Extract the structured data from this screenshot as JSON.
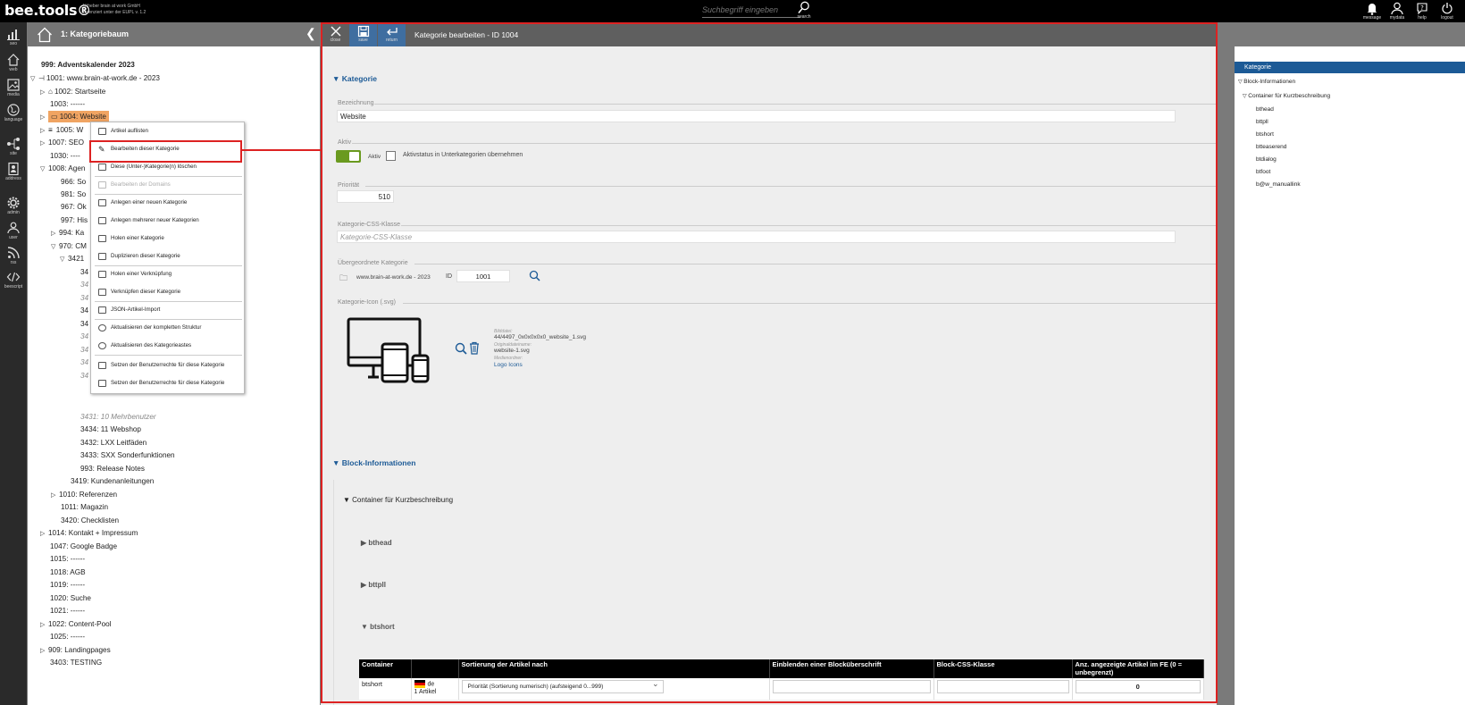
{
  "app": {
    "logo": "bee.tools®",
    "copyright_line1": "Urheber brain at work GmbH",
    "copyright_line2": "Lizenziert unter der EUPL v. 1.2",
    "search_placeholder": "Suchbegriff eingeben",
    "search_label": "search",
    "top_actions": [
      {
        "label": "message",
        "icon": "bell-icon"
      },
      {
        "label": "mydata",
        "icon": "user-icon"
      },
      {
        "label": "help",
        "icon": "help-icon"
      },
      {
        "label": "logout",
        "icon": "logout-icon"
      }
    ]
  },
  "leftnav": [
    {
      "label": "seo",
      "icon": "chart-icon"
    },
    {
      "label": "web",
      "icon": "home-icon"
    },
    {
      "label": "media",
      "icon": "image-icon"
    },
    {
      "label": "language",
      "icon": "globe-icon"
    },
    {
      "label": "site",
      "icon": "sitemap-icon"
    },
    {
      "label": "address",
      "icon": "address-icon"
    },
    {
      "label": "admin",
      "icon": "gear-icon"
    },
    {
      "label": "user",
      "icon": "users-icon"
    },
    {
      "label": "rss",
      "icon": "rss-icon"
    },
    {
      "label": "beescript",
      "icon": "code-icon"
    }
  ],
  "tree": {
    "title": "1: Kategoriebaum",
    "items": [
      {
        "label": "999: Adventskalender 2023"
      },
      {
        "label": "1001: www.brain-at-work.de - 2023"
      },
      {
        "label": "1002: Startseite"
      },
      {
        "label": "1003: ------"
      },
      {
        "label": "1004: Website"
      },
      {
        "label": "1005: W"
      },
      {
        "label": "1007: SEO"
      },
      {
        "label": "1030: ----"
      },
      {
        "label": "1008: Agen"
      },
      {
        "label": "966: So"
      },
      {
        "label": "981: So"
      },
      {
        "label": "967: Ök"
      },
      {
        "label": "997: His"
      },
      {
        "label": "994: Ka"
      },
      {
        "label": "970: CM"
      },
      {
        "label": "3421"
      },
      {
        "label": "34"
      },
      {
        "label": "34"
      },
      {
        "label": "34"
      },
      {
        "label": "34"
      },
      {
        "label": "34"
      },
      {
        "label": "34"
      },
      {
        "label": "34"
      },
      {
        "label": "34"
      },
      {
        "label": "34"
      },
      {
        "label": "3431: 10 Mehrbenutzer"
      },
      {
        "label": "3434: 11 Webshop"
      },
      {
        "label": "3432: LXX Leitfäden"
      },
      {
        "label": "3433: SXX Sonderfunktionen"
      },
      {
        "label": "993: Release Notes"
      },
      {
        "label": "3419: Kundenanleitungen"
      },
      {
        "label": "1010: Referenzen"
      },
      {
        "label": "1011: Magazin"
      },
      {
        "label": "3420: Checklisten"
      },
      {
        "label": "1014: Kontakt + Impressum"
      },
      {
        "label": "1047: Google Badge"
      },
      {
        "label": "1015: ------"
      },
      {
        "label": "1018: AGB"
      },
      {
        "label": "1019: ------"
      },
      {
        "label": "1020: Suche"
      },
      {
        "label": "1021: ------"
      },
      {
        "label": "1022: Content-Pool"
      },
      {
        "label": "1025: ------"
      },
      {
        "label": "909: Landingpages"
      },
      {
        "label": "3403: TESTING"
      }
    ]
  },
  "context_menu": [
    {
      "label": "Artikel auflisten"
    },
    {
      "label": "Bearbeiten dieser Kategorie"
    },
    {
      "label": "Diese (Unter-)Kategorie(n) löschen"
    },
    {
      "label": "Bearbeiten der Domains"
    },
    {
      "label": "Anlegen einer neuen Kategorie"
    },
    {
      "label": "Anlegen mehrerer neuer Kategorien"
    },
    {
      "label": "Holen einer Kategorie"
    },
    {
      "label": "Duplizieren dieser Kategorie"
    },
    {
      "label": "Holen einer Verknüpfung"
    },
    {
      "label": "Verknüpfen dieser Kategorie"
    },
    {
      "label": "JSON-Artikel-Import"
    },
    {
      "label": "Aktualisieren der kompletten Struktur"
    },
    {
      "label": "Aktualisieren des Kategorieastes"
    },
    {
      "label": "Setzen der Benutzerrechte für diese Kategorie"
    },
    {
      "label": "Setzen der Benutzerrechte für diese Kategorie"
    }
  ],
  "editor": {
    "buttons": [
      {
        "label": "close",
        "icon": "close-icon"
      },
      {
        "label": "save",
        "icon": "save-icon"
      },
      {
        "label": "return",
        "icon": "return-icon"
      }
    ],
    "title": "Kategorie bearbeiten - ID 1004",
    "section_kategorie": "Kategorie",
    "bezeichnung_label": "Bezeichnung",
    "bezeichnung_value": "Website",
    "aktiv_label": "Aktiv",
    "aktiv_toggle_label": "Aktiv",
    "aktivstatus_label": "Aktivstatus in Unterkategorien übernehmen",
    "prioritaet_label": "Priorität",
    "prioritaet_value": "510",
    "css_label": "Kategorie-CSS-Klasse",
    "css_placeholder": "Kategorie-CSS-Klasse",
    "parent_label": "Übergeordnete Kategorie",
    "parent_value": "www.brain-at-work.de - 2023",
    "id_label": "ID",
    "id_value": "1001",
    "icon_label": "Kategorie-Icon (.svg)",
    "meta": {
      "file_label": "Bilddatei:",
      "file_value": "44/4497_0x0x0x0x0_website_1.svg",
      "orig_label": "Originaldateiname:",
      "orig_value": "website-1.svg",
      "folder_label": "Medienordner:",
      "folder_value": "Logo Icons"
    },
    "section_block": "Block-Informationen",
    "container_label": "Container für Kurzbeschreibung",
    "blocks": [
      "bthead",
      "bttpll",
      "btshort"
    ],
    "table": {
      "headers": [
        "Container",
        "",
        "Sortierung der Artikel nach",
        "Einblenden einer Blocküberschrift",
        "Block-CSS-Klasse",
        "Anz. angezeigte Artikel im FE (0 = unbegrenzt)"
      ],
      "row": {
        "container": "btshort",
        "lang": "de",
        "count": "1 Artikel",
        "sort": "Priorität (Sortierung numerisch) (aufsteigend 0...999)",
        "limit": "0"
      }
    }
  },
  "right_panel": {
    "selected": "Kategorie",
    "items": [
      "Block-Informationen",
      "Container für Kurzbeschreibung",
      "bthead",
      "bttpll",
      "btshort",
      "btteaserend",
      "btdialog",
      "btfoot",
      "b@w_manuallink"
    ]
  },
  "colors": {
    "accent": "#1c5a96",
    "selected_tree_item": "#f0a462",
    "toggle_on": "#6a9a1f",
    "highlight": "#dd2222"
  }
}
